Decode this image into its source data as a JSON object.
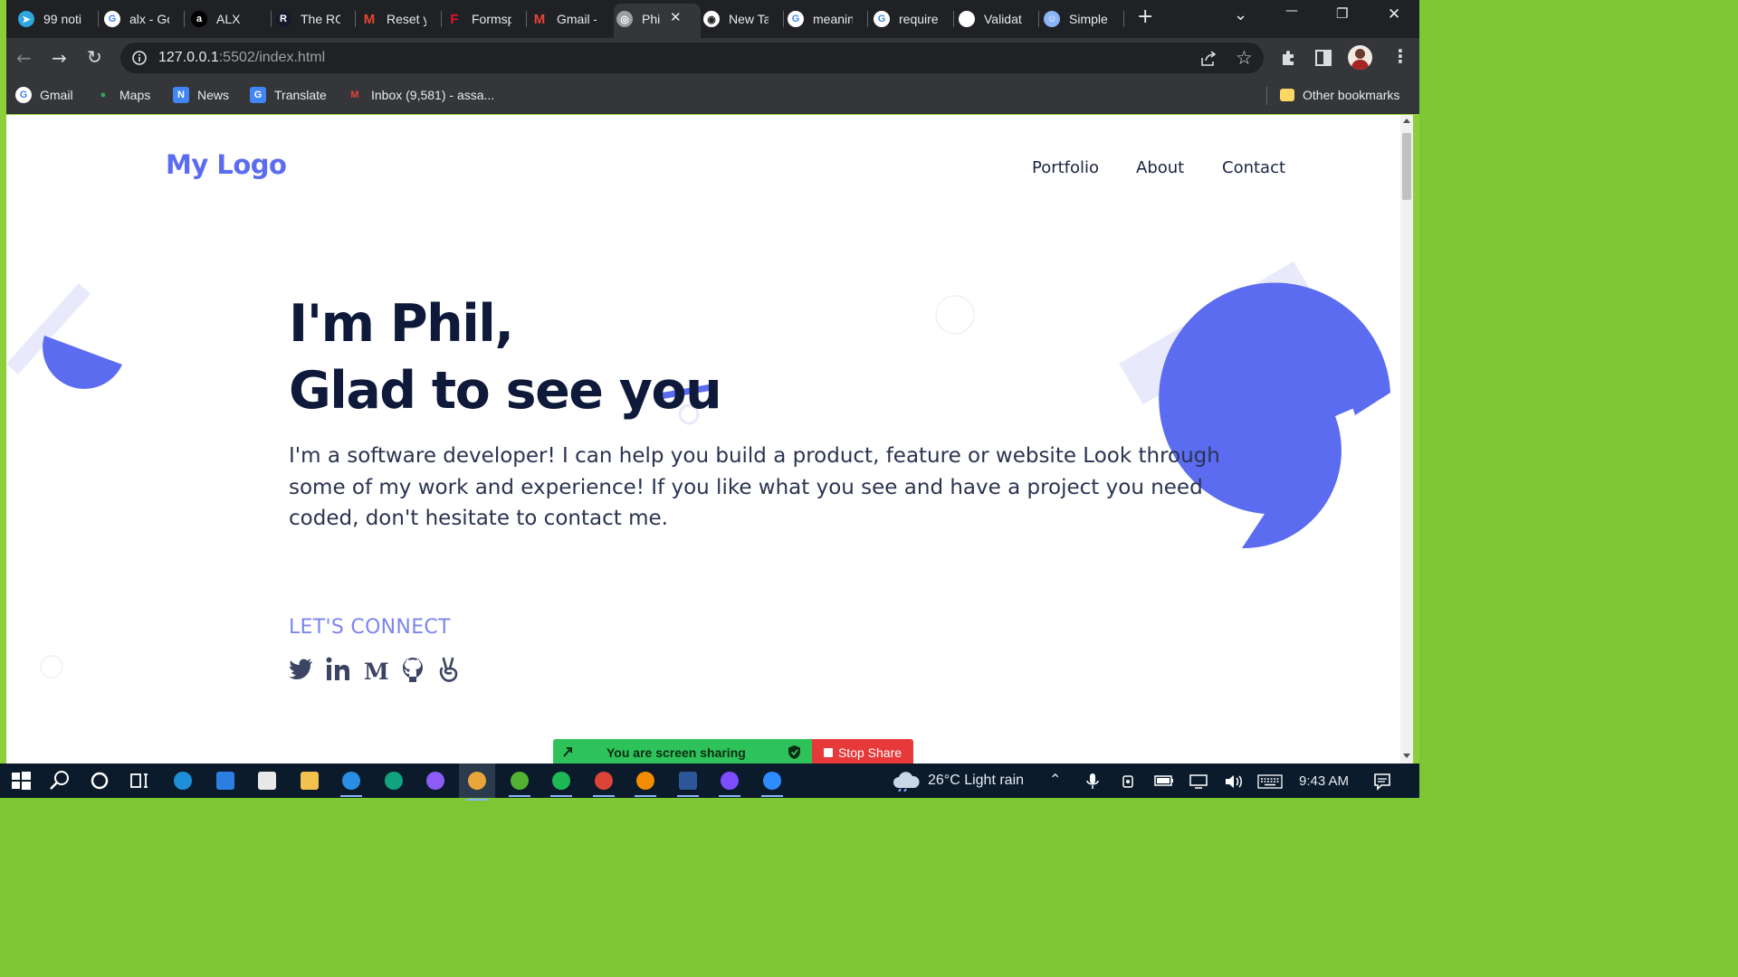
{
  "browser": {
    "tabs": [
      {
        "label": "99 noti",
        "icon": "telegram-icon",
        "color": "#2ea6de"
      },
      {
        "label": "alx - Go",
        "icon": "google-icon",
        "color": "#4285f4"
      },
      {
        "label": "ALX",
        "icon": "alx-icon",
        "color": "#000000"
      },
      {
        "label": "The RO",
        "icon": "r-icon",
        "color": "#1a1a2e"
      },
      {
        "label": "Reset y",
        "icon": "gmail-icon",
        "color": "#ea4335"
      },
      {
        "label": "Formsp",
        "icon": "formspree-icon",
        "color": "#e5122e"
      },
      {
        "label": "Gmail -",
        "icon": "gmail-icon",
        "color": "#ea4335"
      },
      {
        "label": "Phi",
        "icon": "globe-icon",
        "color": "#9aa0a6"
      },
      {
        "label": "New Ta",
        "icon": "chrome-icon",
        "color": "#e8eaed"
      },
      {
        "label": "meanin",
        "icon": "google-icon",
        "color": "#4285f4"
      },
      {
        "label": "require",
        "icon": "google-icon",
        "color": "#4285f4"
      },
      {
        "label": "Validat",
        "icon": "graduation-cap-icon",
        "color": "#ffffff"
      },
      {
        "label": "Simple",
        "icon": "robot-icon",
        "color": "#8ab4f8"
      }
    ],
    "url_host": "127.0.0.1",
    "url_path": ":5502/index.html",
    "bookmarks": [
      "Gmail",
      "Maps",
      "News",
      "Translate",
      "Inbox (9,581) - assa..."
    ],
    "other_bookmarks": "Other bookmarks"
  },
  "site": {
    "logo": "My Logo",
    "nav": [
      "Portfolio",
      "About",
      "Contact"
    ],
    "hero_line1": "I'm Phil,",
    "hero_line2": "Glad to see you",
    "description": "I'm a software developer! I can help you build a product, feature or website Look through some of my work and experience! If you like what you see and have a project you need coded, don't hesitate to contact me.",
    "connect_heading": "LET'S CONNECT",
    "social_icons": [
      "twitter-icon",
      "linkedin-icon",
      "medium-icon",
      "github-icon",
      "angellist-icon"
    ],
    "colors": {
      "accent": "#5b6cf0",
      "heading": "#0f1a3b",
      "text": "#2b3350",
      "decor_light": "#e8e9fb"
    }
  },
  "screen_share": {
    "status": "You are screen sharing",
    "stop_label": "Stop Share"
  },
  "taskbar": {
    "weather": "26°C  Light rain",
    "time": "9:43 AM"
  }
}
